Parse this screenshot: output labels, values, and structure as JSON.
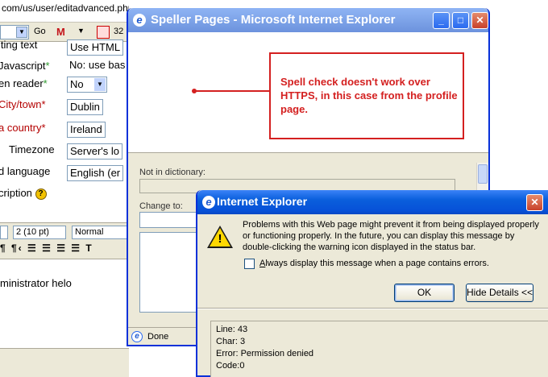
{
  "background_page": {
    "url_fragment": "com/us/user/editadvanced.php?",
    "toolbar": {
      "go_label": "Go",
      "gmail_glyph": "M",
      "count": "32"
    },
    "form_rows": [
      {
        "label": "iting text",
        "required": false,
        "field": "Use HTML"
      },
      {
        "label": "Javascript",
        "required": true,
        "field": "No: use bas"
      },
      {
        "label": "en reader",
        "required": true,
        "field": "No"
      },
      {
        "label": "City/town",
        "required": true,
        "field": "Dublin"
      },
      {
        "label": "a country",
        "required": true,
        "field": "Ireland"
      },
      {
        "label": "Timezone",
        "required": false,
        "field": "Server's lo"
      },
      {
        "label": "d language",
        "required": false,
        "field": "English (er"
      },
      {
        "label": "cription",
        "required": false,
        "field": ""
      }
    ],
    "required_mark": "*",
    "help_icon_glyph": "?",
    "editor": {
      "size_select": "2 (10 pt)",
      "style_select": "Normal",
      "format_glyphs": "¶ ¶‹ ☰ ☰ ☰ ☰ T",
      "text": "ministrator helo"
    }
  },
  "speller": {
    "title": "Speller Pages - Microsoft Internet Explorer",
    "not_in_dictionary_label": "Not in dictionary:",
    "change_to_label": "Change to:",
    "status_text": "Done",
    "title_buttons": [
      "_",
      "□",
      "✕"
    ]
  },
  "annotation": {
    "text": "Spell check doesn't work over HTTPS, in this case from the profile page.",
    "color": "#d42020"
  },
  "ie_dialog": {
    "title": "Internet Explorer",
    "close_glyph": "✕",
    "message": "Problems with this Web page might prevent it from being displayed properly or functioning properly. In the future, you can display this message by double-clicking the warning icon displayed in the status bar.",
    "checkbox_label": "Always display this message when a page contains errors.",
    "checkbox_checked": false,
    "ok_label": "OK",
    "hide_details_label": "Hide Details <<",
    "details": [
      {
        "key": "Line:",
        "value": "43"
      },
      {
        "key": "Char:",
        "value": "3"
      },
      {
        "key": "Error:",
        "value": "Permission denied"
      },
      {
        "key": "Code:",
        "value": "0"
      }
    ]
  },
  "colors": {
    "xp_title_blue": "#0a5fdc",
    "window_face": "#ece9d8",
    "required_green": "#2e9a2e",
    "required_red": "#b40000"
  }
}
